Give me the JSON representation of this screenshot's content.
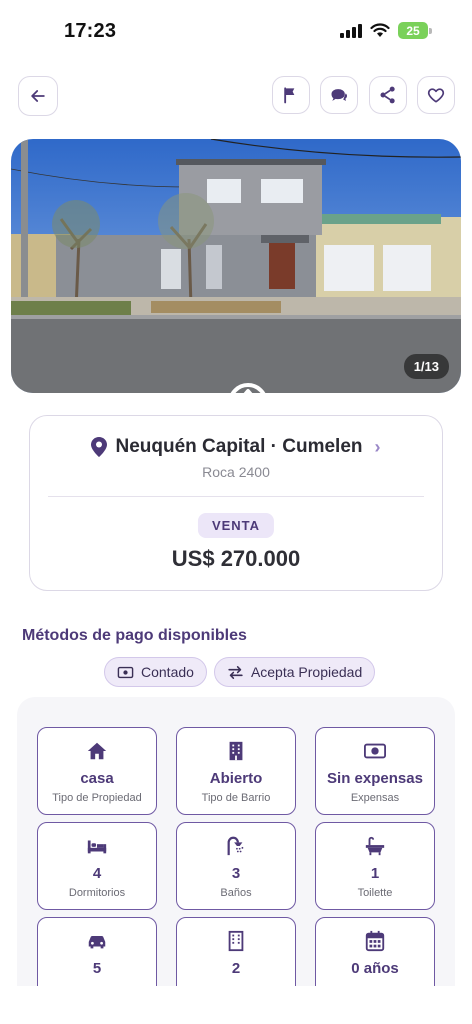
{
  "status_bar": {
    "time": "17:23",
    "battery": "25"
  },
  "hero": {
    "photo_counter": "1/13"
  },
  "location": {
    "title": "Neuquén Capital · Cumelen",
    "address": "Roca 2400"
  },
  "listing": {
    "operation": "VENTA",
    "price": "US$ 270.000"
  },
  "payment": {
    "title": "Métodos de pago disponibles",
    "methods": [
      {
        "label": "Contado",
        "icon": "cash-icon"
      },
      {
        "label": "Acepta Propiedad",
        "icon": "swap-icon"
      }
    ]
  },
  "features": [
    {
      "value": "casa",
      "label": "Tipo de Propiedad",
      "icon": "house-icon"
    },
    {
      "value": "Abierto",
      "label": "Tipo de Barrio",
      "icon": "building-icon"
    },
    {
      "value": "Sin expensas",
      "label": "Expensas",
      "icon": "cash-icon"
    },
    {
      "value": "4",
      "label": "Dormitorios",
      "icon": "bed-icon"
    },
    {
      "value": "3",
      "label": "Baños",
      "icon": "shower-icon"
    },
    {
      "value": "1",
      "label": "Toilette",
      "icon": "bathtub-icon"
    },
    {
      "value": "5",
      "label": "",
      "icon": "car-icon"
    },
    {
      "value": "2",
      "label": "",
      "icon": "floors-icon"
    },
    {
      "value": "0 años",
      "label": "",
      "icon": "calendar-icon"
    }
  ],
  "colors": {
    "accent": "#4d3a78",
    "border": "#dcd8e6",
    "chip_bg": "#efeaf8"
  }
}
